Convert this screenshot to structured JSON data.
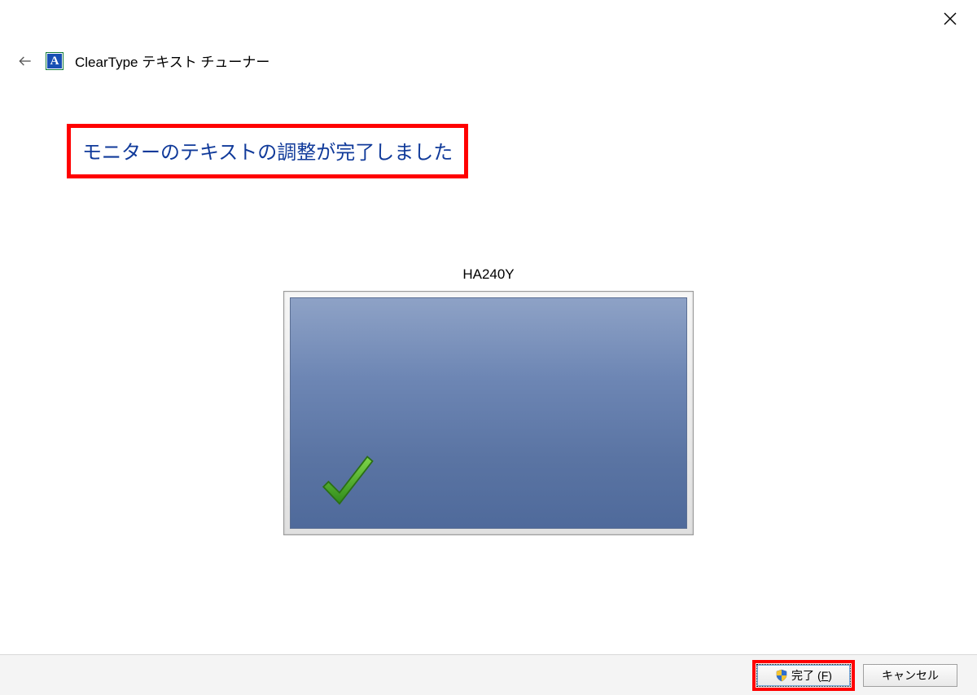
{
  "window": {
    "title": "ClearType テキスト チューナー"
  },
  "heading": "モニターのテキストの調整が完了しました",
  "monitor": {
    "name": "HA240Y"
  },
  "buttons": {
    "finish_label": "完了",
    "finish_accel": "F",
    "cancel_label": "キャンセル"
  },
  "icons": {
    "app_letter": "A"
  }
}
